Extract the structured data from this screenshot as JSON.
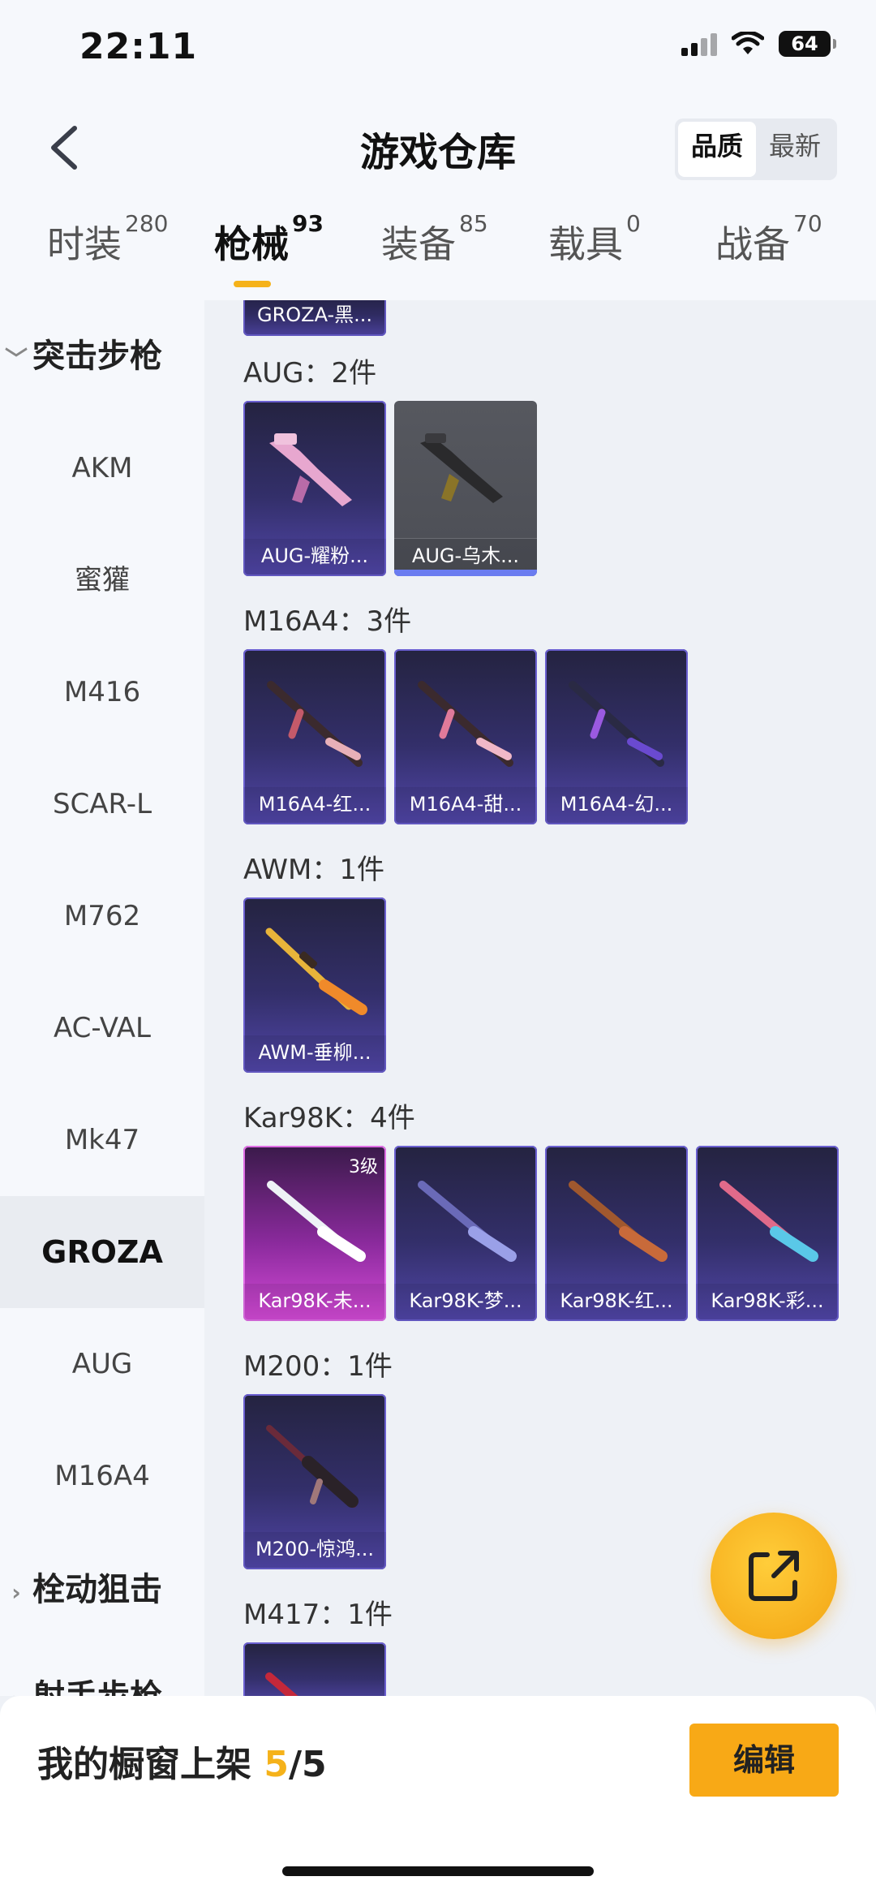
{
  "status": {
    "time": "22:11",
    "battery": "64"
  },
  "header": {
    "title": "游戏仓库",
    "sort_options": [
      "品质",
      "最新"
    ],
    "tabs": [
      {
        "label": "时装",
        "count": "280"
      },
      {
        "label": "枪械",
        "count": "93"
      },
      {
        "label": "装备",
        "count": "85"
      },
      {
        "label": "载具",
        "count": "0"
      },
      {
        "label": "战备",
        "count": "70"
      }
    ]
  },
  "sidebar": {
    "group_assault": "突击步枪",
    "items": [
      "AKM",
      "蜜獾",
      "M416",
      "SCAR-L",
      "M762",
      "AC-VAL",
      "Mk47",
      "GROZA",
      "AUG",
      "M16A4"
    ],
    "group_sniper": "栓动狙击",
    "group_marksman": "射手步枪"
  },
  "content": {
    "partial_top": "GROZA-黑...",
    "sections": [
      {
        "title": "AUG：2件",
        "items": [
          "AUG-耀粉...",
          "AUG-乌木..."
        ]
      },
      {
        "title": "M16A4：3件",
        "items": [
          "M16A4-红...",
          "M16A4-甜...",
          "M16A4-幻..."
        ]
      },
      {
        "title": "AWM：1件",
        "items": [
          "AWM-垂柳..."
        ]
      },
      {
        "title": "Kar98K：4件",
        "items": [
          "Kar98K-未...",
          "Kar98K-梦...",
          "Kar98K-红...",
          "Kar98K-彩..."
        ],
        "first_badge": "3级"
      },
      {
        "title": "M200：1件",
        "items": [
          "M200-惊鸿..."
        ]
      },
      {
        "title": "M417：1件",
        "items": []
      }
    ]
  },
  "bottom": {
    "label": "我的橱窗上架 ",
    "count": "5",
    "total": "/5",
    "edit": "编辑"
  },
  "colors": {
    "accent": "#f5b21a",
    "card_purple": "#3a3473"
  }
}
